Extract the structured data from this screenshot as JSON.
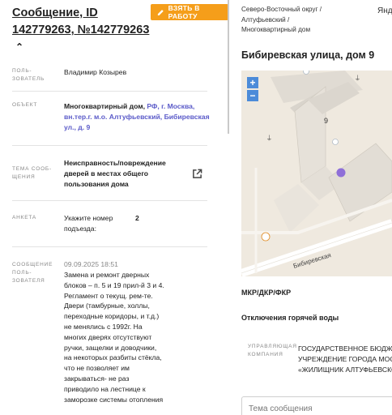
{
  "request": {
    "title": "Сообщение, ID 142779263, №142779263",
    "take_label": "ВЗЯТЬ В РАБОТУ"
  },
  "fields": {
    "user_label_1": "ПОЛЬ-",
    "user_label_2": "ЗОВАТЕЛЬ",
    "user_value": "Владимир Козырев",
    "object_label": "ОБЪЕКТ",
    "object_type": "Многоквартирный дом, ",
    "object_line1_link": "РФ, г. Москва,",
    "object_line2_link": "вн.тер.г. м.о. Алтуфьевский, Бибиревская",
    "object_line3_link": "ул., д. 9",
    "topic_label_1": "ТЕМА СООБ-",
    "topic_label_2": "ЩЕНИЯ",
    "topic_line1": "Неисправность/повреждение",
    "topic_line2": "дверей в местах общего",
    "topic_line3": "пользования дома",
    "survey_label": "АНКЕТА",
    "survey_question_1": "Укажите номер",
    "survey_question_2": "подъезда:",
    "survey_answer": "2",
    "msg_label_1": "СООБЩЕНИЕ",
    "msg_label_2": "ПОЛЬ-",
    "msg_label_3": "ЗОВАТЕЛЯ",
    "msg_date": "09.09.2025 18:51",
    "msg_lines": [
      "Замена и ремонт дверных",
      "блоков – п. 5 и 19 прил-й 3 и 4.",
      "Регламент о текущ. рем-те.",
      "Двери (тамбурные, холлы,",
      "переходные коридоры, и т.д.)",
      "не менялись с 1992г. На",
      "многих дверях отсутствуют",
      "ручки, защелки и доводчики,",
      "на некоторых разбиты стёкла,",
      "что не позволяет им",
      "закрываться- не раз",
      "приводило на лестнице к",
      "заморозке системы отопления"
    ]
  },
  "location": {
    "breadcrumb_1": "Северо-Восточный округ /",
    "breadcrumb_2": "Алтуфьевский /",
    "breadcrumb_3": "Многоквартирный дом",
    "user_cut": "Янд",
    "address": "Бибиревская улица, дом 9",
    "house_number": "9",
    "street_label": "Бибиревская",
    "zoom_in": "+",
    "zoom_out": "−"
  },
  "details": {
    "funding": "МКР/ДКР/ФКР",
    "hot_water": "Отключения горячей воды",
    "mc_label_1": "УПРАВЛЯЮЩАЯ",
    "mc_label_2": "КОМПАНИЯ",
    "mc_line1": "ГОСУДАРСТВЕННОЕ БЮДЖЕТ",
    "mc_line2": "УЧРЕЖДЕНИЕ ГОРОДА МОСК",
    "mc_line3": "«ЖИЛИЩНИК АЛТУФЬЕВСКО",
    "topic_placeholder": "Тема сообщения"
  },
  "colors": {
    "accent": "#f59e1a",
    "link": "#5b5bc9",
    "map_marker": "#8f6fd8"
  }
}
